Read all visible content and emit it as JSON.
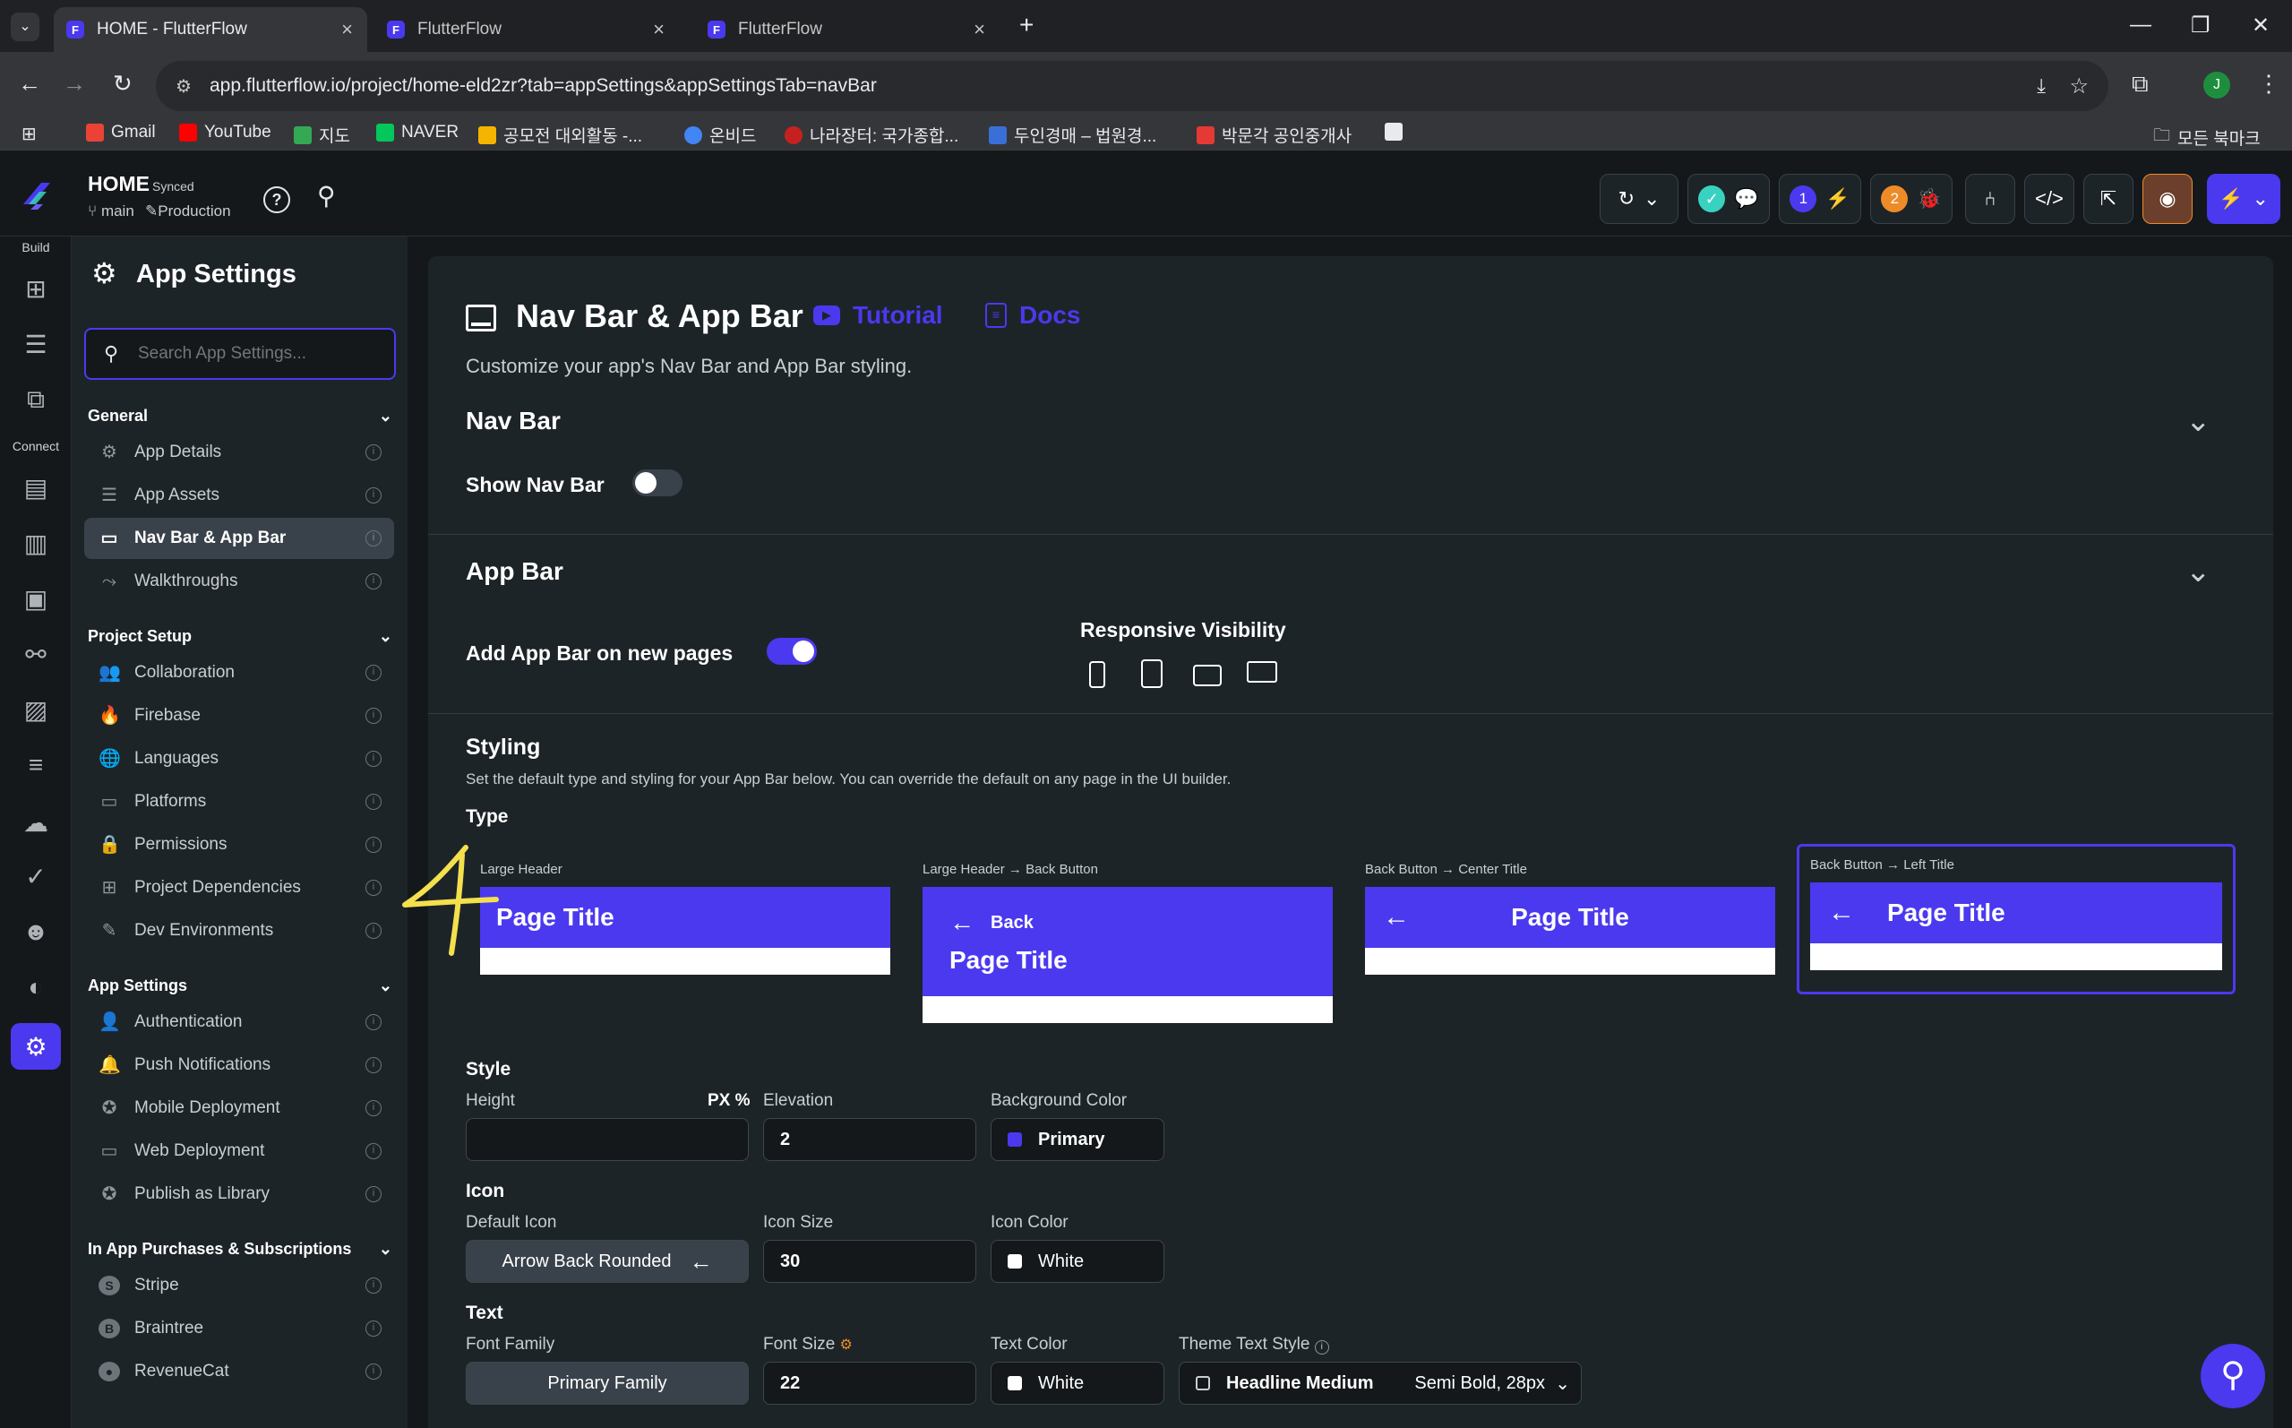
{
  "browser": {
    "tabs": [
      {
        "title": "HOME - FlutterFlow",
        "active": true
      },
      {
        "title": "FlutterFlow",
        "active": false
      },
      {
        "title": "FlutterFlow",
        "active": false
      }
    ],
    "url": "app.flutterflow.io/project/home-eld2zr?tab=appSettings&appSettingsTab=navBar",
    "profile_initial": "J",
    "bookmarks": [
      "Gmail",
      "YouTube",
      "지도",
      "NAVER",
      "공모전 대외활동 -...",
      "온비드",
      "나라장터: 국가종합...",
      "두인경매 – 법원경...",
      "박문각 공인중개사"
    ],
    "all_bookmarks": "모든 북마크"
  },
  "header": {
    "project_name": "HOME",
    "sync_status": "Synced",
    "branch": "main",
    "environment": "Production",
    "badge_one": "1",
    "badge_two": "2"
  },
  "rail": {
    "build_label": "Build",
    "connect_label": "Connect"
  },
  "sidebar": {
    "title": "App Settings",
    "search_placeholder": "Search App Settings...",
    "sections": [
      {
        "label": "General",
        "items": [
          "App Details",
          "App Assets",
          "Nav Bar & App Bar",
          "Walkthroughs"
        ]
      },
      {
        "label": "Project Setup",
        "items": [
          "Collaboration",
          "Firebase",
          "Languages",
          "Platforms",
          "Permissions",
          "Project Dependencies",
          "Dev Environments"
        ]
      },
      {
        "label": "App Settings",
        "items": [
          "Authentication",
          "Push Notifications",
          "Mobile Deployment",
          "Web Deployment",
          "Publish as Library"
        ]
      },
      {
        "label": "In App Purchases & Subscriptions",
        "items": [
          "Stripe",
          "Braintree",
          "RevenueCat"
        ]
      }
    ],
    "selected": "Nav Bar & App Bar"
  },
  "main": {
    "title": "Nav Bar & App Bar",
    "tutorial_link": "Tutorial",
    "docs_link": "Docs",
    "description": "Customize your app's Nav Bar and App Bar styling.",
    "navbar": {
      "heading": "Nav Bar",
      "show_label": "Show Nav Bar",
      "show_enabled": false
    },
    "appbar": {
      "heading": "App Bar",
      "add_label": "Add App Bar on new pages",
      "add_enabled": true,
      "responsive_label": "Responsive Visibility"
    },
    "styling": {
      "heading": "Styling",
      "description": "Set the default type and styling for your App Bar below. You can override the default on any page in the UI builder.",
      "type_label": "Type",
      "types": [
        {
          "caption": "Large Header",
          "title": "Page Title",
          "back": ""
        },
        {
          "caption": "Large Header → Back Button",
          "title": "Page Title",
          "back": "Back"
        },
        {
          "caption": "Back Button → Center Title",
          "title": "Page Title",
          "back": ""
        },
        {
          "caption": "Back Button → Left Title",
          "title": "Page Title",
          "back": "",
          "selected": true
        }
      ],
      "style_label": "Style",
      "height_label": "Height",
      "height_units": "PX %",
      "height_value": "",
      "elevation_label": "Elevation",
      "elevation_value": "2",
      "bg_color_label": "Background Color",
      "bg_color_value": "Primary",
      "icon_label": "Icon",
      "default_icon_label": "Default Icon",
      "default_icon_value": "Arrow Back Rounded",
      "icon_size_label": "Icon Size",
      "icon_size_value": "30",
      "icon_color_label": "Icon Color",
      "icon_color_value": "White",
      "text_label": "Text",
      "font_family_label": "Font Family",
      "font_family_value": "Primary Family",
      "font_size_label": "Font Size",
      "font_size_value": "22",
      "text_color_label": "Text Color",
      "text_color_value": "White",
      "theme_style_label": "Theme Text Style",
      "theme_style_value": "Headline Medium",
      "theme_style_detail": "Semi Bold, 28px"
    }
  },
  "colors": {
    "primary": "#4b39ef",
    "panel": "#1d2428",
    "background": "#14181b",
    "annotation": "#f4e04d"
  }
}
